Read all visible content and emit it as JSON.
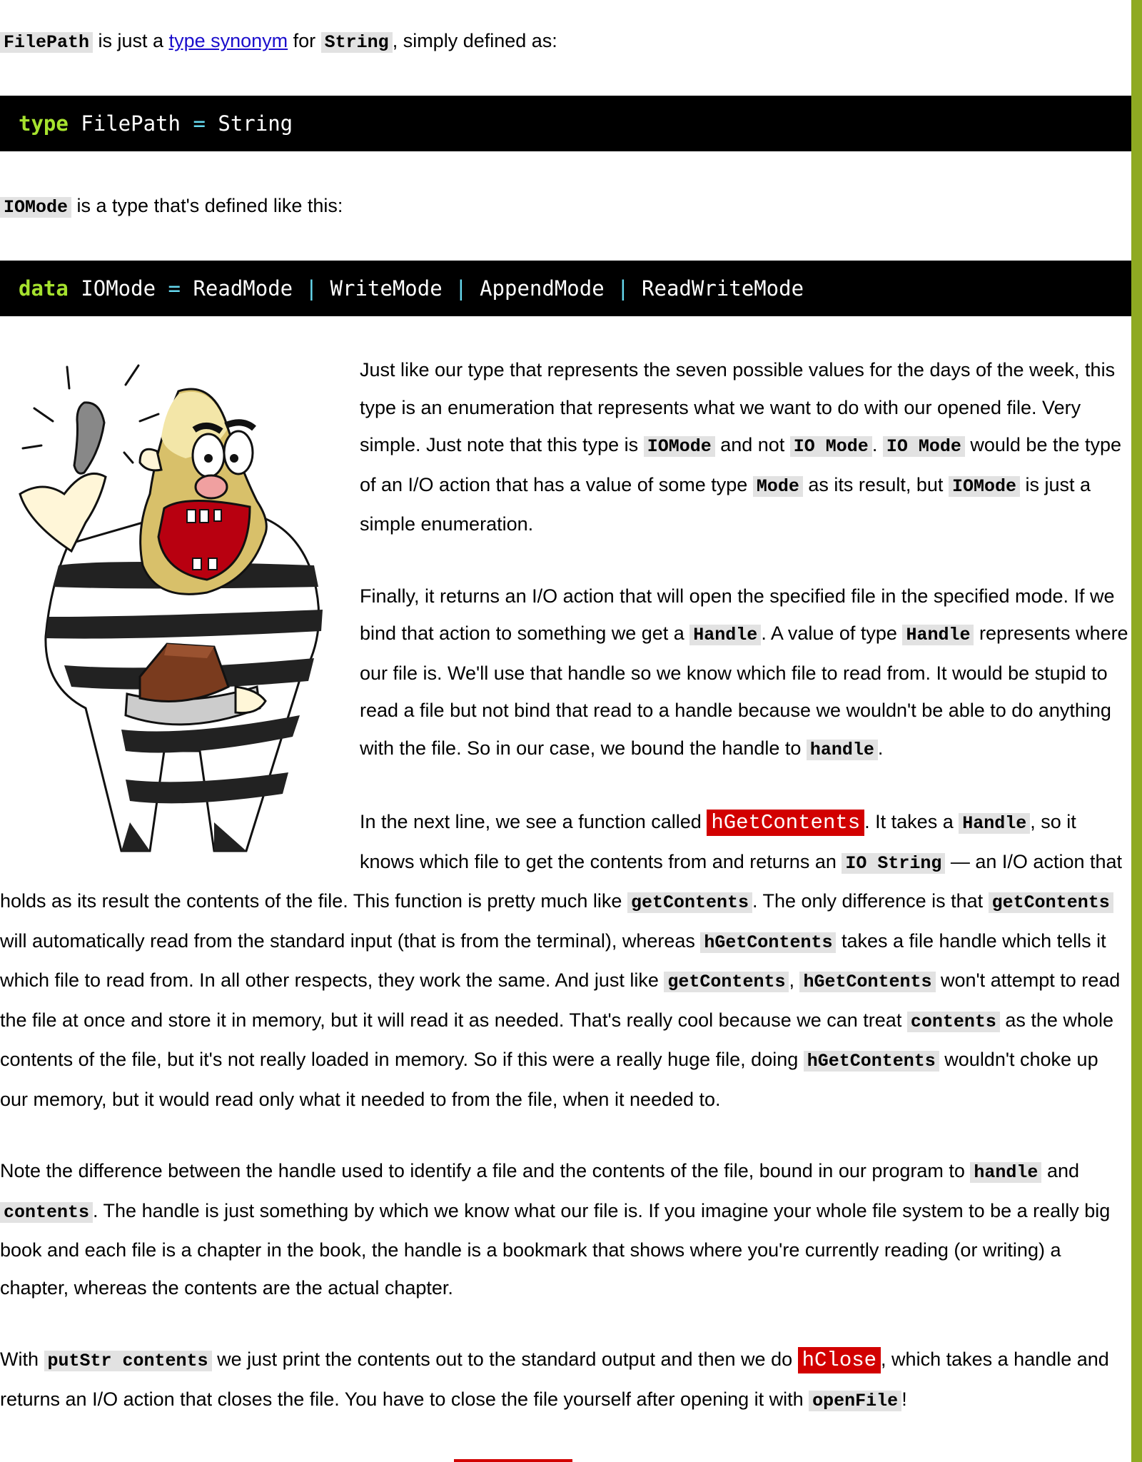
{
  "intro": {
    "filepath_code": "FilePath",
    "t1": " is just a ",
    "link": "type synonym",
    "t2": " for ",
    "string_code": "String",
    "t3": ", simply defined as:"
  },
  "code1": {
    "kw": "type",
    "rest": " FilePath ",
    "eq": "=",
    "rhs": " String"
  },
  "iomode_intro": {
    "code": "IOMode",
    "text": " is a type that's defined like this:"
  },
  "code2": {
    "kw": "data",
    "name": " IOMode ",
    "eq": "=",
    "c1": " ReadMode ",
    "bar": "|",
    "c2": " WriteMode ",
    "c3": " AppendMode ",
    "c4": " ReadWriteMode"
  },
  "illustration": {
    "name": "prisoner-eating-cake-illustration"
  },
  "p1": {
    "a": "Just like our type that represents the seven possible values for the days of the week, this type is an enumeration that represents what we want to do with our opened file. Very simple. Just note that this type is ",
    "c1": "IOMode",
    "b": " and not ",
    "c2": "IO Mode",
    "c": ". ",
    "c3": "IO Mode",
    "d": " would be the type of an I/O action that has a value of some type ",
    "c4": "Mode",
    "e": " as its result, but ",
    "c5": "IOMode",
    "f": " is just a simple enumeration."
  },
  "p2": {
    "a": "Finally, it returns an I/O action that will open the specified file in the specified mode. If we bind that action to something we get a ",
    "c1": "Handle",
    "b": ". A value of type ",
    "c2": "Handle",
    "c": " represents where our file is. We'll use that handle so we know which file to read from. It would be stupid to read a file but not bind that read to a handle because we wouldn't be able to do anything with the file. So in our case, we bound the handle to ",
    "c3": "handle",
    "d": "."
  },
  "p3": {
    "a": "In the next line, we see a function called ",
    "fn": "hGetContents",
    "b": ". It takes a ",
    "c1": "Handle",
    "c": ", so it knows which file to get the contents from and returns an ",
    "c2": "IO String",
    "d": " — an I/O action that holds as its result the contents of the file. This function is pretty much like ",
    "c3": "getContents",
    "e": ". The only difference is that ",
    "c4": "getContents",
    "f": " will automatically read from the standard input (that is from the terminal), whereas ",
    "c5": "hGetContents",
    "g": " takes a file handle which tells it which file to read from. In all other respects, they work the same. And just like ",
    "c6": "getContents",
    "h": ", ",
    "c7": "hGetContents",
    "i": " won't attempt to read the file at once and store it in memory, but it will read it as needed. That's really cool because we can treat ",
    "c8": "contents",
    "j": " as the whole contents of the file, but it's not really loaded in memory. So if this were a really huge file, doing ",
    "c9": "hGetContents",
    "k": " wouldn't choke up our memory, but it would read only what it needed to from the file, when it needed to."
  },
  "p4": {
    "a": "Note the difference between the handle used to identify a file and the contents of the file, bound in our program to ",
    "c1": "handle",
    "b": " and ",
    "c2": "contents",
    "c": ". The handle is just something by which we know what our file is. If you imagine your whole file system to be a really big book and each file is a chapter in the book, the handle is a bookmark that shows where you're currently reading (or writing) a chapter, whereas the contents are the actual chapter."
  },
  "p5": {
    "a": "With ",
    "c1": "putStr contents",
    "b": " we just print the contents out to the standard output and then we do ",
    "fn": "hClose",
    "c": ", which takes a handle and returns an I/O action that closes the file. You have to close the file yourself after opening it with ",
    "c2": "openFile",
    "d": "!"
  },
  "colors": {
    "sidebar": "#8faa22",
    "code_bg": "#000000",
    "keyword": "#a6e22e",
    "operator": "#66d9ef",
    "highlight_bg": "#d20000",
    "inline_code_bg": "#e2e2e2"
  }
}
